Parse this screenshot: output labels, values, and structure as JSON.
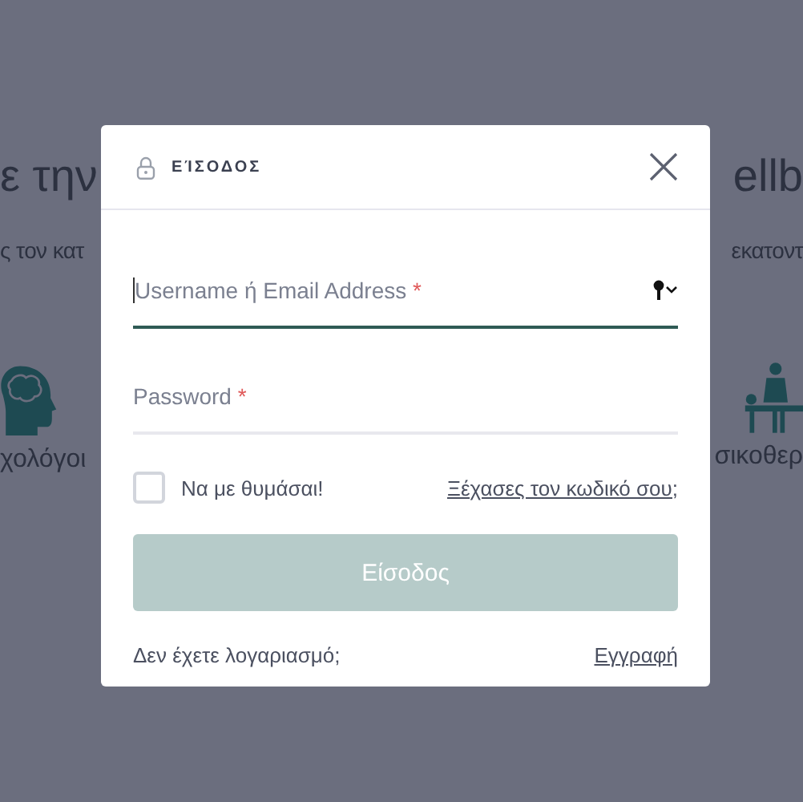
{
  "background": {
    "left": {
      "heading": "ε την",
      "subheading": "ς τον κατ",
      "category": "χολόγοι"
    },
    "right": {
      "heading": "ellb",
      "subheading": "εκατοντ",
      "category": "σικοθερ"
    }
  },
  "dialog": {
    "title": "ΕΊΣΟΔΟΣ",
    "fields": [
      {
        "placeholder": "Username ή Email Address",
        "required_mark": "*",
        "focused": true,
        "autofill_icon": true
      },
      {
        "placeholder": "Password",
        "required_mark": "*",
        "focused": false,
        "autofill_icon": false
      }
    ],
    "remember": {
      "label": "Να με θυμάσαι!",
      "checked": false
    },
    "forgot_link": "Ξέχασες τον κωδικό σου;",
    "submit": {
      "label": "Είσοδος",
      "disabled": true
    },
    "footer": {
      "text": "Δεν έχετε λογαριασμό;",
      "link": "Εγγραφή"
    }
  }
}
